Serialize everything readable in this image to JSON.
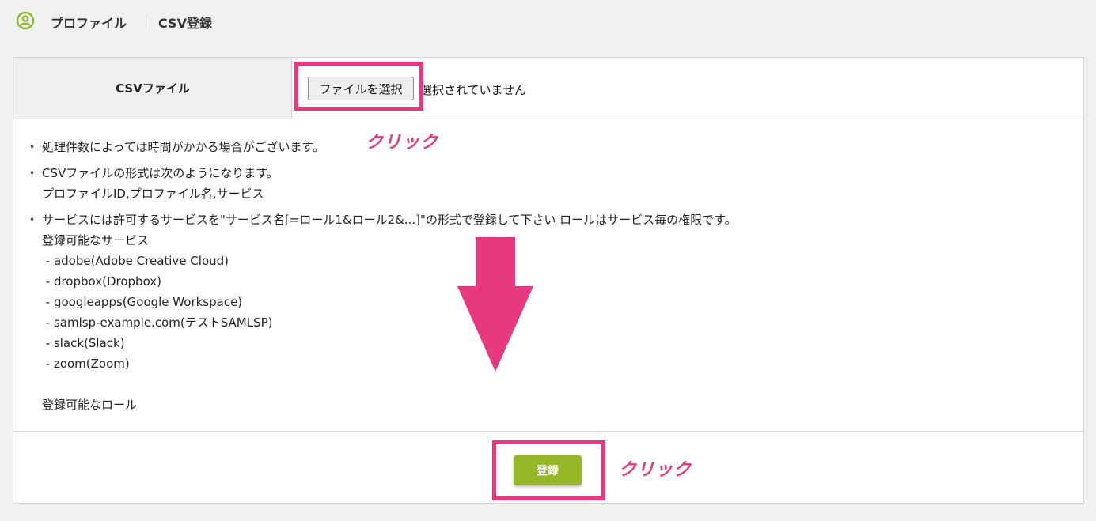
{
  "header": {
    "breadcrumb_1": "プロファイル",
    "breadcrumb_2": "CSV登録",
    "icon": "profile-circle-icon"
  },
  "form": {
    "csv_label": "CSVファイル",
    "file_button_label": "ファイルを選択",
    "file_status": "選択されていません"
  },
  "notes": [
    {
      "lines": [
        "処理件数によっては時間がかかる場合がございます。"
      ]
    },
    {
      "lines": [
        "CSVファイルの形式は次のようになります。",
        "プロファイルID,プロファイル名,サービス"
      ]
    },
    {
      "lines": [
        "サービスには許可するサービスを\"サービス名[=ロール1&ロール2&...]\"の形式で登録して下さい ロールはサービス毎の権限です。",
        "登録可能なサービス",
        " - adobe(Adobe Creative Cloud)",
        " - dropbox(Dropbox)",
        " - googleapps(Google Workspace)",
        " - samlsp-example.com(テストSAMLSP)",
        " - slack(Slack)",
        " - zoom(Zoom)",
        "",
        "登録可能なロール"
      ]
    }
  ],
  "submit_label": "登録",
  "annotations": {
    "click_label_1": "クリック",
    "click_label_2": "クリック",
    "highlight_color": "#e6397f"
  },
  "colors": {
    "submit_bg": "#96b826",
    "label_cell_bg": "#efefef",
    "page_bg": "#f1f1f1"
  }
}
